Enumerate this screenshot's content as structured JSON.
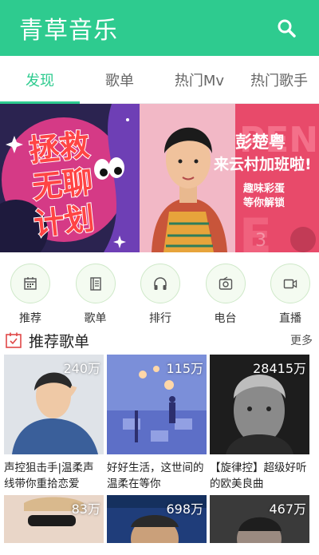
{
  "header": {
    "title": "青草音乐",
    "search_icon": "search-icon"
  },
  "tabs": [
    {
      "label": "发现",
      "active": true
    },
    {
      "label": "歌单",
      "active": false
    },
    {
      "label": "热门Mv",
      "active": false
    },
    {
      "label": "热门歌手",
      "active": false
    }
  ],
  "banner": {
    "left_text": [
      "拯救",
      "无聊",
      "计划"
    ],
    "bg_word": "PENG",
    "headline": "彭楚粤",
    "subline": "来云村加班啦!",
    "tagline1": "趣味彩蛋",
    "tagline2": "等你解锁"
  },
  "quick_nav": [
    {
      "label": "推荐",
      "icon": "calendar-icon"
    },
    {
      "label": "歌单",
      "icon": "book-icon"
    },
    {
      "label": "排行",
      "icon": "headphones-icon"
    },
    {
      "label": "电台",
      "icon": "radio-icon"
    },
    {
      "label": "直播",
      "icon": "video-camera-icon"
    }
  ],
  "section": {
    "title": "推荐歌单",
    "more": "更多",
    "icon": "calendar-check-icon"
  },
  "playlists": [
    {
      "count": "240万",
      "title": "声控狙击手|温柔声线带你重拾恋爱"
    },
    {
      "count": "115万",
      "title": "好好生活，这世间的温柔在等你"
    },
    {
      "count": "28415万",
      "title": "【旋律控】超级好听的欧美良曲"
    },
    {
      "count": "83万",
      "title": ""
    },
    {
      "count": "698万",
      "title": ""
    },
    {
      "count": "467万",
      "title": ""
    }
  ],
  "colors": {
    "accent": "#2ecb8f",
    "banner_pink": "#e84a6a"
  }
}
